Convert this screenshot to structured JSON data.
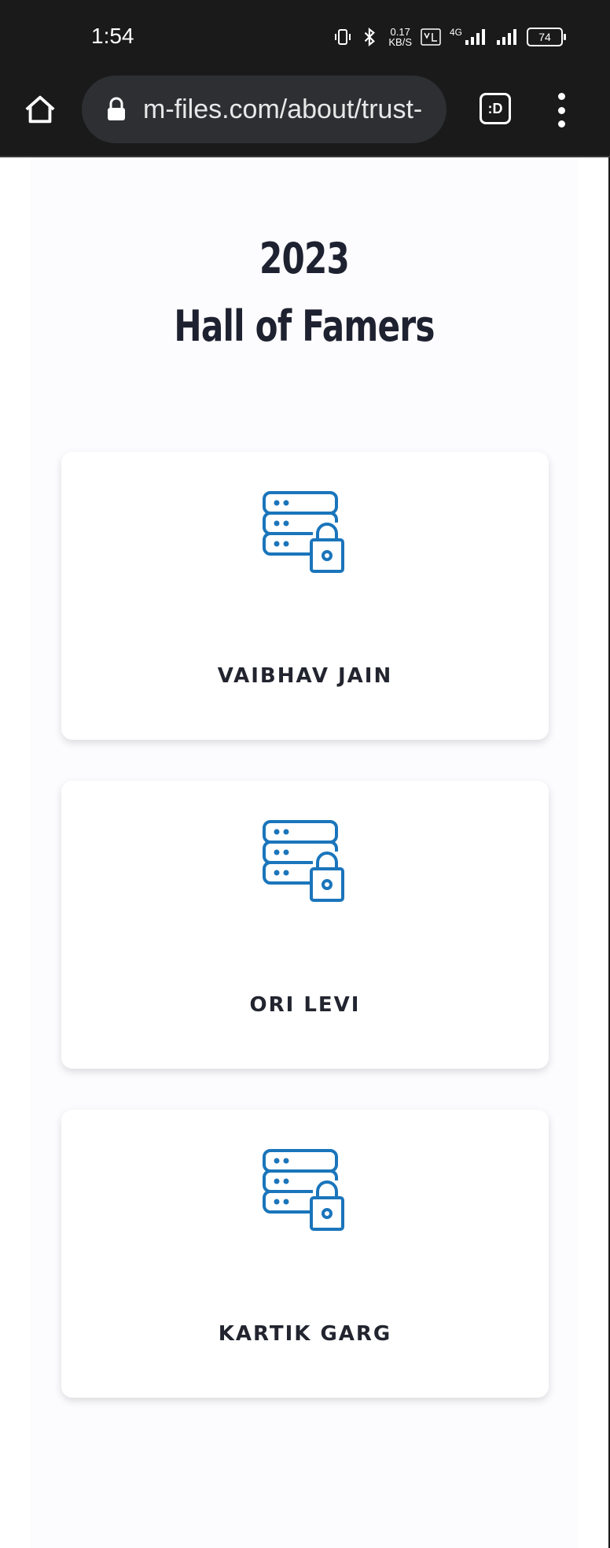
{
  "status_bar": {
    "time": "1:54",
    "speed_value": "0.17",
    "speed_unit": "KB/S",
    "network": "4G",
    "battery": "74",
    "icons": [
      "vibrate-icon",
      "bluetooth-icon",
      "volte-icon",
      "signal-icon",
      "signal-icon",
      "battery-icon"
    ]
  },
  "browser": {
    "url": "m-files.com/about/trust-",
    "tabs_label": ":D",
    "icons": [
      "home-icon",
      "lock-icon",
      "tabs-icon",
      "more-vert-icon"
    ]
  },
  "page": {
    "year": "2023",
    "title": "Hall of Famers",
    "cards": [
      {
        "name": "VAIBHAV JAIN",
        "icon": "server-lock-icon"
      },
      {
        "name": "ORI LEVI",
        "icon": "server-lock-icon"
      },
      {
        "name": "KARTIK GARG",
        "icon": "server-lock-icon"
      }
    ],
    "accent_color": "#1a75bb"
  }
}
